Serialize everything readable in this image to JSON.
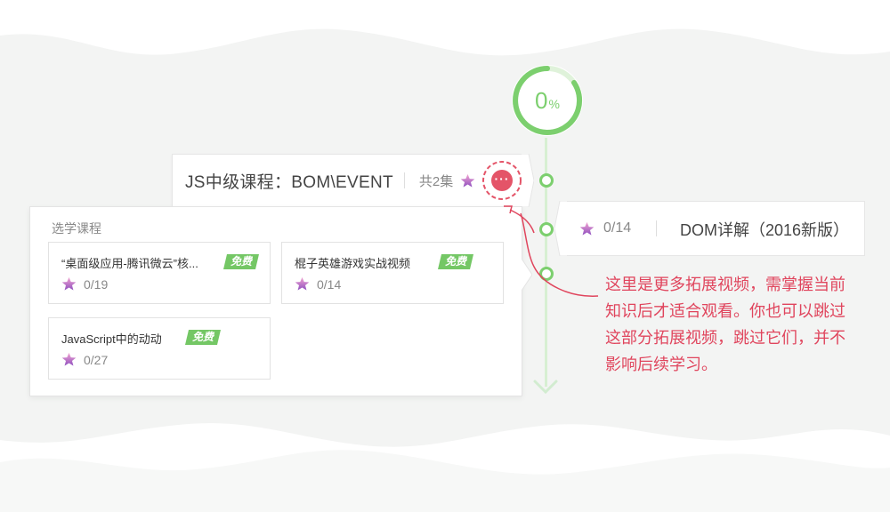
{
  "progress": {
    "value": "0",
    "unit": "%",
    "fraction": 0.0
  },
  "course": {
    "title": "JS中级课程：BOM\\EVENT",
    "count": "共2集",
    "more_label": "···"
  },
  "elective": {
    "title": "选学课程",
    "free_label": "免费",
    "items": [
      {
        "name": "“桌面级应用-腾讯微云”核...",
        "progress": "0/19"
      },
      {
        "name": "棍子英雄游戏实战视频",
        "progress": "0/14"
      },
      {
        "name": "JavaScript中的动动",
        "progress": "0/27"
      }
    ]
  },
  "dom": {
    "progress": "0/14",
    "title": "DOM详解（2016新版）"
  },
  "annotation": {
    "lines": [
      "这里是更多拓展视频，需掌握当前",
      "知识后才适合观看。你也可以跳过",
      "这部分拓展视频，跳过它们，并不",
      "影响后续学习。"
    ]
  },
  "colors": {
    "accent_green": "#7ccf6e",
    "accent_red": "#e45468",
    "free_green": "#74c765",
    "text_red": "#e0455d"
  },
  "icons": [
    "star-icon",
    "more-icon",
    "chevron-down-icon"
  ]
}
